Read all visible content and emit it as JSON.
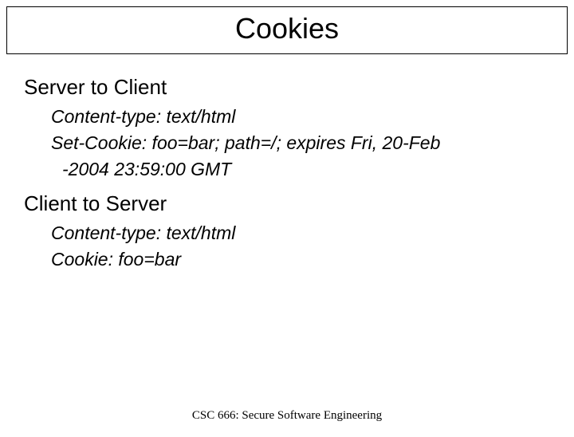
{
  "title": "Cookies",
  "section1": {
    "heading": "Server to Client",
    "line1": "Content-type: text/html",
    "line2": "Set-Cookie: foo=bar; path=/; expires Fri, 20-Feb",
    "line3": "-2004 23:59:00 GMT"
  },
  "section2": {
    "heading": "Client to Server",
    "line1": "Content-type: text/html",
    "line2": "Cookie: foo=bar"
  },
  "footer": "CSC 666: Secure Software Engineering"
}
